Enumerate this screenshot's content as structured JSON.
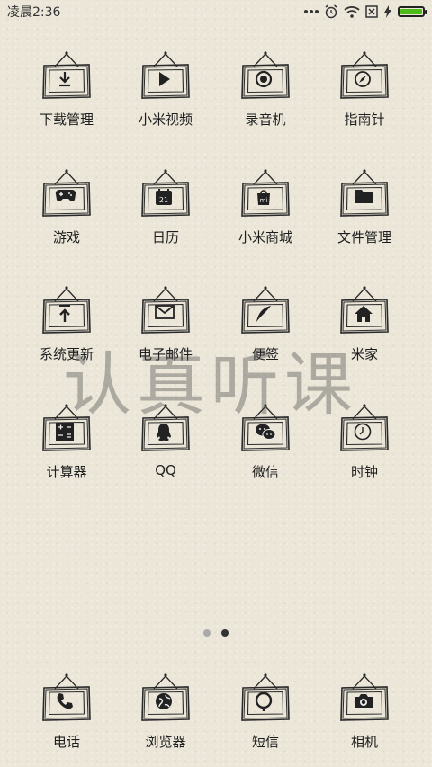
{
  "status": {
    "time": "凌晨2:36",
    "icons": [
      "more-dots-icon",
      "alarm-icon",
      "wifi-icon",
      "no-sim-icon",
      "charging-icon",
      "battery-icon"
    ],
    "battery_color": "#4cbb17"
  },
  "apps": [
    {
      "label": "下载管理",
      "icon": "download-icon"
    },
    {
      "label": "小米视频",
      "icon": "play-icon"
    },
    {
      "label": "录音机",
      "icon": "record-icon"
    },
    {
      "label": "指南针",
      "icon": "compass-icon"
    },
    {
      "label": "游戏",
      "icon": "gamepad-icon"
    },
    {
      "label": "日历",
      "icon": "calendar-icon",
      "icon_text": "21"
    },
    {
      "label": "小米商城",
      "icon": "mi-store-icon",
      "icon_text": "mi"
    },
    {
      "label": "文件管理",
      "icon": "folder-icon"
    },
    {
      "label": "系统更新",
      "icon": "update-icon"
    },
    {
      "label": "电子邮件",
      "icon": "mail-icon"
    },
    {
      "label": "便签",
      "icon": "feather-icon"
    },
    {
      "label": "米家",
      "icon": "home-icon"
    },
    {
      "label": "计算器",
      "icon": "calculator-icon"
    },
    {
      "label": "QQ",
      "icon": "qq-icon"
    },
    {
      "label": "微信",
      "icon": "wechat-icon"
    },
    {
      "label": "时钟",
      "icon": "clock-icon"
    }
  ],
  "dock": [
    {
      "label": "电话",
      "icon": "phone-icon"
    },
    {
      "label": "浏览器",
      "icon": "browser-icon"
    },
    {
      "label": "短信",
      "icon": "message-icon"
    },
    {
      "label": "相机",
      "icon": "camera-icon"
    }
  ],
  "watermark": "认真听课",
  "pager": {
    "pages": 2,
    "current": 2
  }
}
